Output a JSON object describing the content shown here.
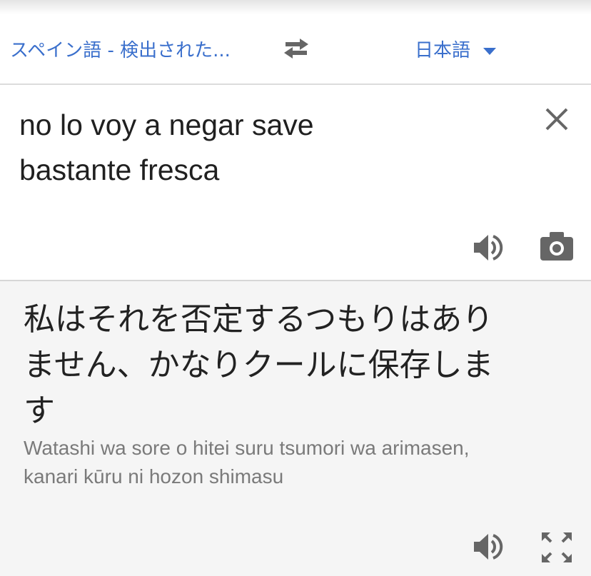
{
  "header": {
    "source_language": "スペイン語 - 検出された...",
    "target_language": "日本語"
  },
  "input": {
    "line1": "no lo voy a negar save",
    "line2": "bastante fresca"
  },
  "output": {
    "line1": "私はそれを否定するつもりはあり",
    "line2": "ません、かなりクールに保存しま",
    "line3": "す",
    "romanization_line1": "Watashi wa sore o hitei suru tsumori wa arimasen,",
    "romanization_line2": "kanari kūru ni hozon shimasu"
  },
  "icons": {
    "swap": "swap-arrows-icon",
    "dropdown": "caret-down-icon",
    "clear": "close-icon",
    "speaker": "speaker-icon",
    "camera": "camera-icon",
    "expand": "fullscreen-icon"
  },
  "colors": {
    "accent": "#3a6fcc",
    "icon": "#666666",
    "output_bg": "#f5f5f5"
  }
}
